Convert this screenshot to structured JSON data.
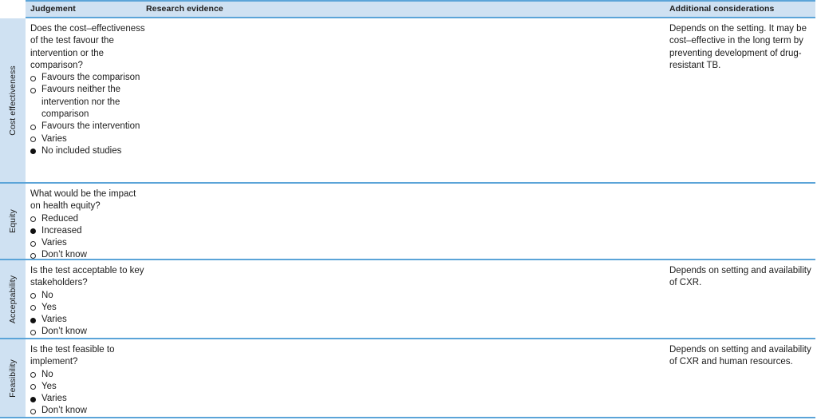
{
  "table": {
    "headers": {
      "judgement": "Judgement",
      "research_evidence": "Research evidence",
      "additional_considerations": "Additional considerations"
    },
    "colors": {
      "header_fill": "#cfe1f2",
      "rule": "#5ba4d8",
      "text": "#1c1c1c",
      "radio_selected": "#111111"
    },
    "rows": [
      {
        "domain": "Cost effectiveness",
        "question": "Does the cost–effectiveness of the test favour the intervention or the comparison?",
        "options": [
          {
            "label": "Favours the comparison",
            "selected": false
          },
          {
            "label": "Favours neither the intervention nor the comparison",
            "selected": false
          },
          {
            "label": "Favours the intervention",
            "selected": false
          },
          {
            "label": "Varies",
            "selected": false
          },
          {
            "label": "No included studies",
            "selected": true
          }
        ],
        "research_evidence": "",
        "additional_considerations": "Depends on the setting. It may be cost–effective in the long term by preventing development of drug-resistant TB."
      },
      {
        "domain": "Equity",
        "question": "What would be the impact on health equity?",
        "options": [
          {
            "label": "Reduced",
            "selected": false
          },
          {
            "label": "Increased",
            "selected": true
          },
          {
            "label": "Varies",
            "selected": false
          },
          {
            "label": "Don’t know",
            "selected": false
          }
        ],
        "research_evidence": "",
        "additional_considerations": ""
      },
      {
        "domain": "Acceptability",
        "question": "Is the test acceptable to key stakeholders?",
        "options": [
          {
            "label": "No",
            "selected": false
          },
          {
            "label": "Yes",
            "selected": false
          },
          {
            "label": "Varies",
            "selected": true
          },
          {
            "label": "Don’t know",
            "selected": false
          }
        ],
        "research_evidence": "",
        "additional_considerations": "Depends on setting and availability of CXR."
      },
      {
        "domain": "Feasibility",
        "question": "Is the test feasible to implement?",
        "options": [
          {
            "label": "No",
            "selected": false
          },
          {
            "label": "Yes",
            "selected": false
          },
          {
            "label": "Varies",
            "selected": true
          },
          {
            "label": "Don’t know",
            "selected": false
          }
        ],
        "research_evidence": "",
        "additional_considerations": "Depends on setting and availability of CXR and human resources."
      }
    ]
  }
}
